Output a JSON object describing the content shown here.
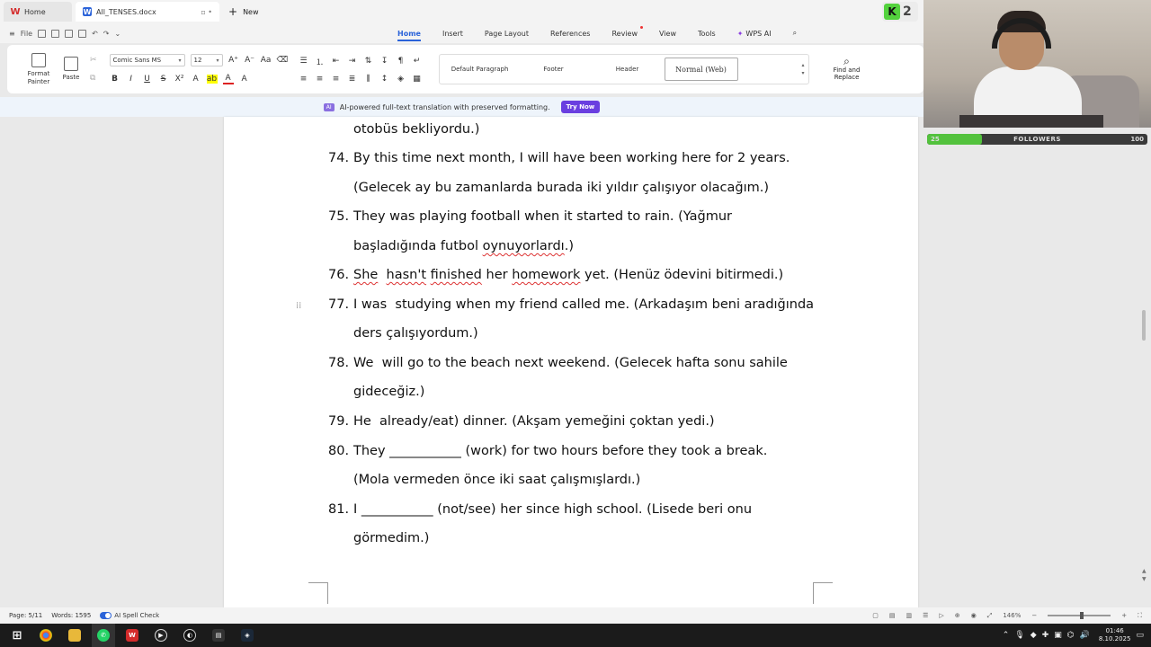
{
  "tabs": {
    "home": "Home",
    "doc": "All_TENSES.docx",
    "new": "New"
  },
  "menu": {
    "file": "File",
    "items": [
      "Home",
      "Insert",
      "Page Layout",
      "References",
      "Review",
      "View",
      "Tools",
      "WPS AI"
    ]
  },
  "ribbon": {
    "format_painter": "Format Painter",
    "paste": "Paste",
    "font_name": "Comic Sans MS",
    "font_size": "12",
    "styles": [
      "Default Paragraph",
      "Footer",
      "Header",
      "Normal (Web)"
    ],
    "find_replace": "Find and Replace"
  },
  "banner": {
    "text": "AI-powered full-text translation with preserved formatting.",
    "button": "Try Now"
  },
  "document": {
    "top_cont": "otobüs bekliyordu.)",
    "items": [
      {
        "num": "74.",
        "line1": "By this time next month, I will have been working here for 2 years.",
        "line2": "(Gelecek ay bu zamanlarda burada iki yıldır çalışıyor olacağım.)"
      },
      {
        "num": "75.",
        "line1": "They was playing football when it started to rain. (Yağmur",
        "line2a": "başladığında futbol ",
        "line2b": "oynuyorlardı",
        "line2c": ".)"
      },
      {
        "num": "76.",
        "w1": "She",
        "w2": "hasn't",
        "w3": "finished",
        "w4": " her ",
        "w5": "homework",
        "w6": " yet. (Henüz ödevini bitirmedi.)"
      },
      {
        "num": "77.",
        "line1": "I was  studying when my friend called me. (Arkadaşım beni aradığında",
        "line2": "ders çalışıyordum.)"
      },
      {
        "num": "78.",
        "line1": "We  will go to the beach next weekend. (Gelecek hafta sonu sahile",
        "line2": "gideceğiz.)"
      },
      {
        "num": "79.",
        "line1": "He  already/eat) dinner. (Akşam yemeğini çoktan yedi.)"
      },
      {
        "num": "80.",
        "line1": "They ___________ (work) for two hours before they took a break.",
        "line2": "(Mola vermeden önce iki saat çalışmışlardı.)"
      },
      {
        "num": "81.",
        "line1": "I ___________ (not/see) her since high school. (Lisede beri onu",
        "line2": "görmedim.)"
      }
    ]
  },
  "status": {
    "page": "Page: 5/11",
    "words": "Words: 1595",
    "spell": "AI Spell Check",
    "zoom": "146%"
  },
  "overlay": {
    "kick_count": "2",
    "followers_label": "FOLLOWERS",
    "followers_current": "25",
    "followers_goal": "100"
  },
  "taskbar": {
    "time": "01:46",
    "date": "8.10.2025"
  },
  "colors": {
    "accent": "#2b63d9",
    "try_now": "#6a3fe0",
    "spell": "#dd3333",
    "kick": "#53d23d"
  }
}
